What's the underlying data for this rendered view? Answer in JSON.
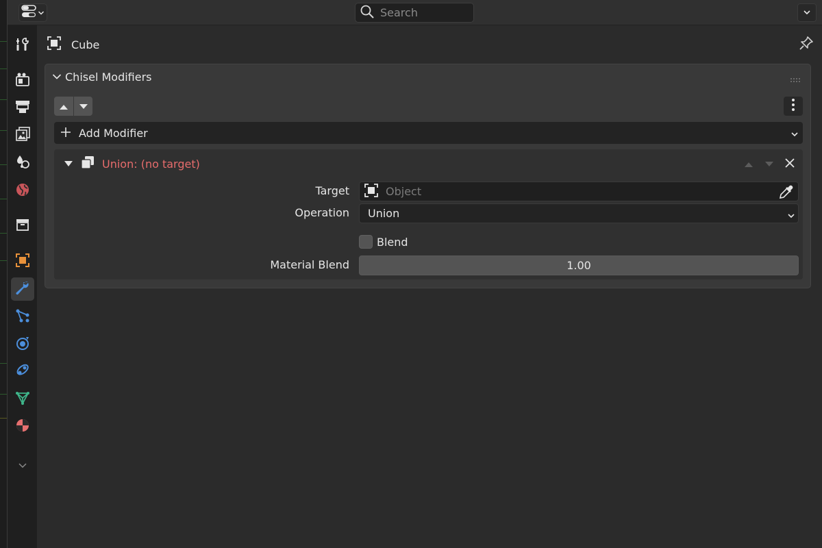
{
  "header": {
    "search_placeholder": "Search",
    "editor_type_icon": "properties-editor-icon",
    "dropdown_icon": "chevron-down-icon"
  },
  "tabs": [
    {
      "name": "tool",
      "icon": "tool-icon",
      "active": false
    },
    {
      "name": "render",
      "icon": "render-icon",
      "active": false
    },
    {
      "name": "output",
      "icon": "output-icon",
      "active": false
    },
    {
      "name": "view-layer",
      "icon": "view-layer-icon",
      "active": false
    },
    {
      "name": "scene",
      "icon": "scene-icon",
      "active": false
    },
    {
      "name": "world",
      "icon": "world-icon",
      "active": false
    },
    {
      "name": "collection",
      "icon": "collection-icon",
      "active": false
    },
    {
      "name": "object",
      "icon": "object-icon",
      "active": false
    },
    {
      "name": "modifiers",
      "icon": "wrench-icon",
      "active": true
    },
    {
      "name": "particles",
      "icon": "particles-icon",
      "active": false
    },
    {
      "name": "physics",
      "icon": "physics-icon",
      "active": false
    },
    {
      "name": "constraints",
      "icon": "constraints-icon",
      "active": false
    },
    {
      "name": "data",
      "icon": "mesh-data-icon",
      "active": false
    },
    {
      "name": "material",
      "icon": "material-icon",
      "active": false
    }
  ],
  "object": {
    "name": "Cube"
  },
  "panel": {
    "title": "Chisel Modifiers",
    "add_modifier_label": "Add Modifier",
    "modifier": {
      "name": "Union: (no target)",
      "name_color": "#e66c6c",
      "target_label": "Target",
      "target_placeholder": "Object",
      "operation_label": "Operation",
      "operation_value": "Union",
      "blend_label": "Blend",
      "blend_checked": false,
      "material_blend_label": "Material Blend",
      "material_blend_value": "1.00"
    }
  },
  "colors": {
    "active_tab_accent": "#4c8fdc",
    "object_orange": "#e8913a",
    "error_red": "#e66c6c"
  }
}
